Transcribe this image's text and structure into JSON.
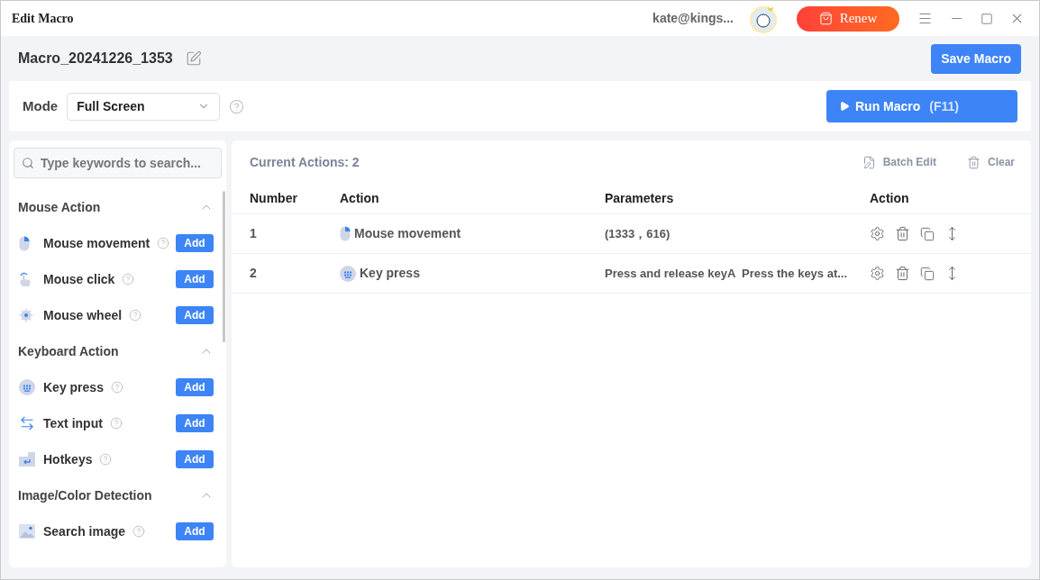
{
  "window": {
    "title": "Edit Macro",
    "user": "kate@kings...",
    "renew_button": "Renew"
  },
  "macro": {
    "name": "Macro_20241226_1353",
    "save_button": "Save Macro"
  },
  "mode": {
    "label": "Mode",
    "value": "Full Screen",
    "run_button": "Run Macro",
    "run_shortcut": "(F11)"
  },
  "sidebar": {
    "search": {
      "placeholder": "Type keywords to search..."
    },
    "groups": [
      {
        "title": "Mouse Action",
        "expanded": true,
        "items": [
          {
            "label": "Mouse movement",
            "kind": "mouse-move",
            "button": "Add"
          },
          {
            "label": "Mouse click",
            "kind": "mouse-click",
            "button": "Add"
          },
          {
            "label": "Mouse wheel",
            "kind": "mouse-wheel",
            "button": "Add"
          }
        ]
      },
      {
        "title": "Keyboard Action",
        "expanded": true,
        "items": [
          {
            "label": "Key press",
            "kind": "keypress",
            "button": "Add"
          },
          {
            "label": "Text input",
            "kind": "text-input",
            "button": "Add"
          },
          {
            "label": "Hotkeys",
            "kind": "hotkeys",
            "button": "Add"
          }
        ]
      },
      {
        "title": "Image/Color Detection",
        "expanded": true,
        "items": [
          {
            "label": "Search image",
            "kind": "image",
            "button": "Add"
          }
        ]
      }
    ]
  },
  "actions": {
    "count_label": "Current Actions: 2",
    "batch_edit": "Batch Edit",
    "clear": "Clear",
    "table": {
      "columns": [
        "Number",
        "Action",
        "Parameters",
        "Action"
      ],
      "rows": [
        {
          "number": "1",
          "action": "Mouse movement",
          "kind": "mouse-move",
          "parameters": "(1333，616)"
        },
        {
          "number": "2",
          "action": "Key press",
          "kind": "keypress",
          "parameters": "Press and release keyA  Press the keys at..."
        }
      ]
    }
  }
}
